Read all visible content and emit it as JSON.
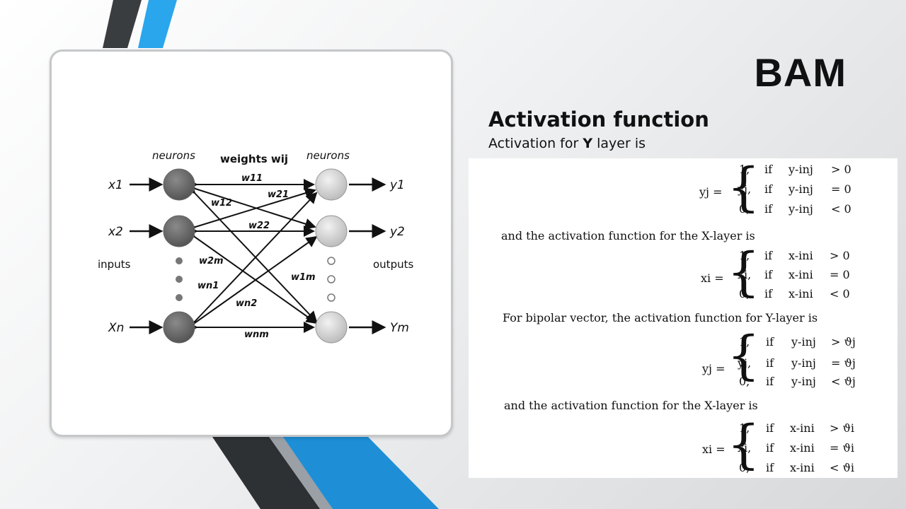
{
  "slide": {
    "title": "BAM",
    "subtitle": "Activation function",
    "intro_prefix": "Activation for ",
    "intro_bold": "Y",
    "intro_suffix": " layer is"
  },
  "diagram": {
    "neurons_left": "neurons",
    "weights_label": "weights wij",
    "neurons_right": "neurons",
    "inputs_label": "inputs",
    "outputs_label": "outputs",
    "x_labels": [
      "x1",
      "x2",
      "Xn"
    ],
    "y_labels": [
      "y1",
      "y2",
      "Ym"
    ],
    "weight_labels": [
      "w11",
      "w21",
      "w12",
      "w22",
      "w2m",
      "w1m",
      "wn1",
      "wn2",
      "wnm"
    ]
  },
  "scan": {
    "text1": "and the activation function for the X-layer is",
    "text2": "For bipolar vector, the activation function for Y-layer is",
    "text3": "and the activation function for the X-layer is",
    "eq1": {
      "lhs": "yj =",
      "cases": [
        [
          "1,",
          "if",
          "y-inj",
          "> 0"
        ],
        [
          "yj,",
          "if",
          "y-inj",
          "= 0"
        ],
        [
          "0,",
          "if",
          "y-inj",
          "< 0"
        ]
      ]
    },
    "eq2": {
      "lhs": "xi =",
      "cases": [
        [
          "1,",
          "if",
          "x-ini",
          "> 0"
        ],
        [
          "xi,",
          "if",
          "x-ini",
          "= 0"
        ],
        [
          "0,",
          "if",
          "x-ini",
          "< 0"
        ]
      ]
    },
    "eq3": {
      "lhs": "yj =",
      "cases": [
        [
          "1,",
          "if",
          "y-inj",
          "> ϑj"
        ],
        [
          "yj,",
          "if",
          "y-inj",
          "= ϑj"
        ],
        [
          "0,",
          "if",
          "y-inj",
          "< ϑj"
        ]
      ]
    },
    "eq4": {
      "lhs": "xi =",
      "cases": [
        [
          "1,",
          "if",
          "x-ini",
          "> ϑi"
        ],
        [
          "xi,",
          "if",
          "x-ini",
          "= ϑi"
        ],
        [
          "0,",
          "if",
          "x-ini",
          "< ϑi"
        ]
      ]
    }
  },
  "colors": {
    "accent_blue": "#1e8fd6",
    "stripe_dark": "#3a3d40"
  }
}
